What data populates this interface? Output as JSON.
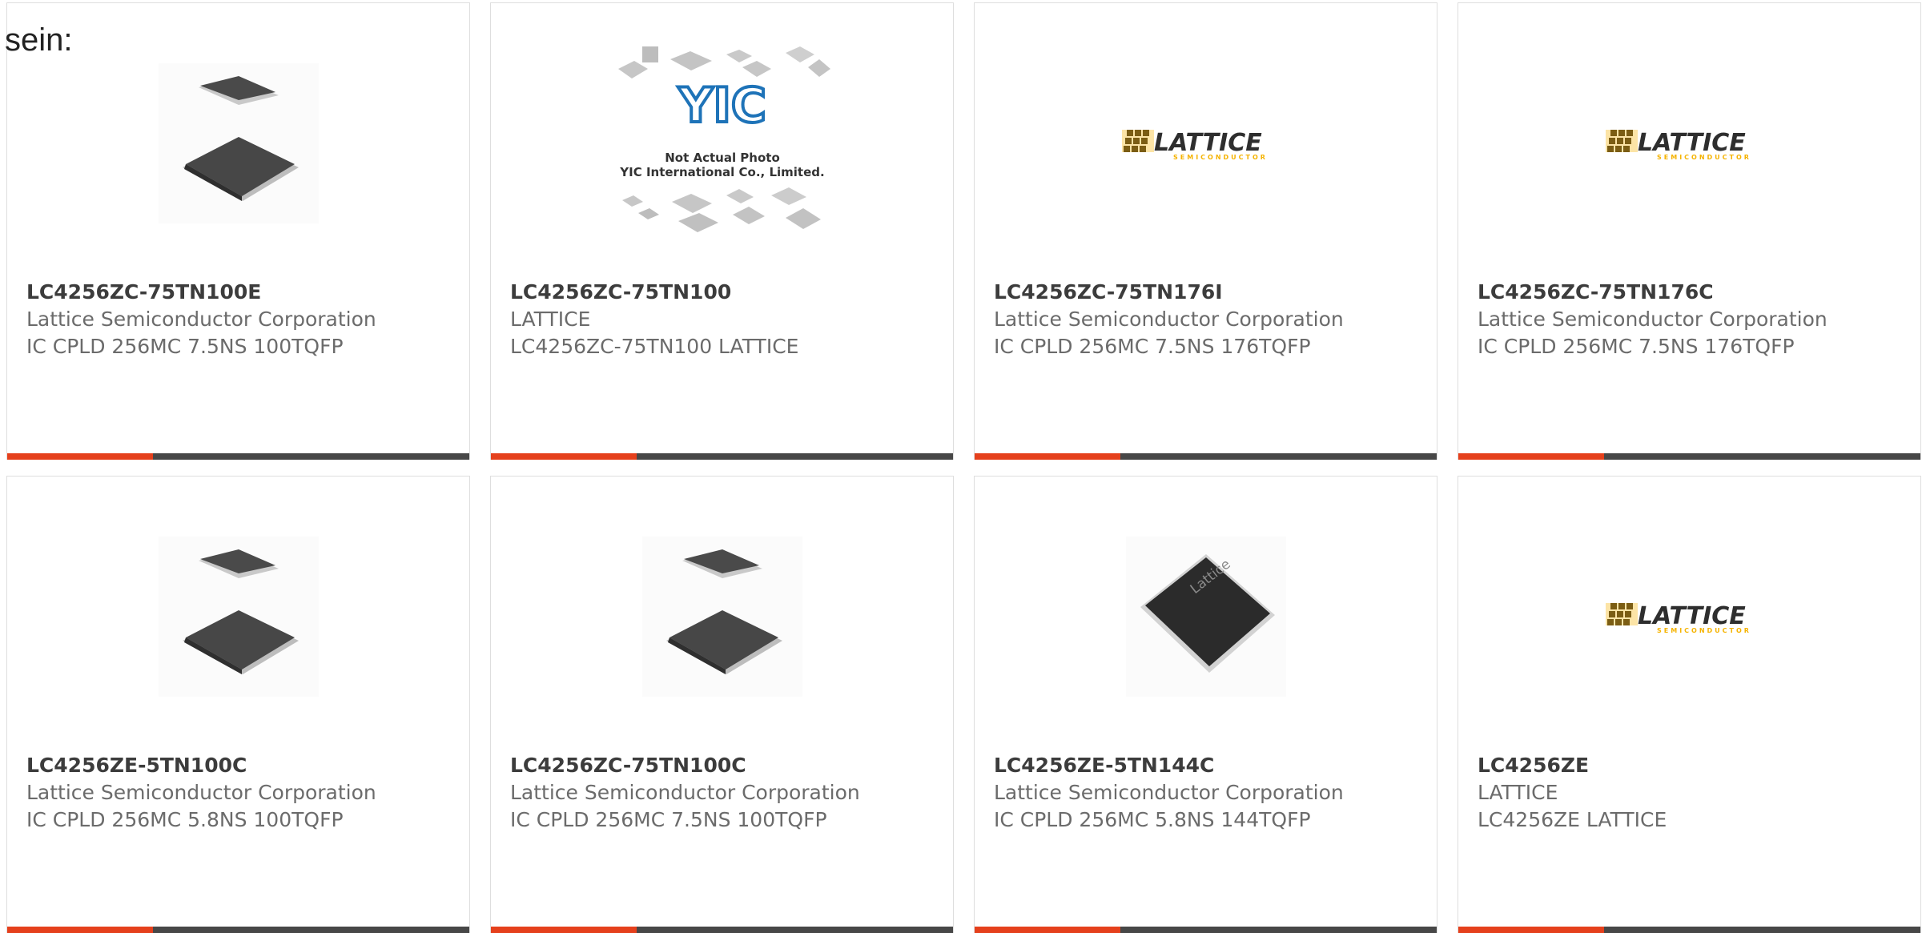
{
  "page": {
    "intro_text": "sein:"
  },
  "colors": {
    "accent": "#e5401c",
    "bar": "#474747",
    "lattice_yellow": "#f5b300"
  },
  "products": [
    {
      "part": "LC4256ZC-75TN100E",
      "manufacturer": "Lattice Semiconductor Corporation",
      "description": "IC CPLD 256MC 7.5NS 100TQFP",
      "image": "tqfp-chips-icon"
    },
    {
      "part": "LC4256ZC-75TN100",
      "manufacturer": "LATTICE",
      "description": "LC4256ZC-75TN100 LATTICE",
      "image": "yic-placeholder-icon",
      "image_caption_1": "Not Actual Photo",
      "image_caption_2": "YIC International Co., Limited.",
      "image_logo": "YIC"
    },
    {
      "part": "LC4256ZC-75TN176I",
      "manufacturer": "Lattice Semiconductor Corporation",
      "description": "IC CPLD 256MC 7.5NS 176TQFP",
      "image": "lattice-logo-icon",
      "logo_text": "LATTICE",
      "logo_sub": "SEMICONDUCTOR"
    },
    {
      "part": "LC4256ZC-75TN176C",
      "manufacturer": "Lattice Semiconductor Corporation",
      "description": "IC CPLD 256MC 7.5NS 176TQFP",
      "image": "lattice-logo-icon",
      "logo_text": "LATTICE",
      "logo_sub": "SEMICONDUCTOR"
    },
    {
      "part": "LC4256ZE-5TN100C",
      "manufacturer": "Lattice Semiconductor Corporation",
      "description": "IC CPLD 256MC 5.8NS 100TQFP",
      "image": "tqfp-chips-icon"
    },
    {
      "part": "LC4256ZC-75TN100C",
      "manufacturer": "Lattice Semiconductor Corporation",
      "description": "IC CPLD 256MC 7.5NS 100TQFP",
      "image": "tqfp-chips-icon"
    },
    {
      "part": "LC4256ZE-5TN144C",
      "manufacturer": "Lattice Semiconductor Corporation",
      "description": "IC CPLD 256MC 5.8NS 144TQFP",
      "image": "lattice-chip-icon",
      "chip_text": "Lattice"
    },
    {
      "part": "LC4256ZE",
      "manufacturer": "LATTICE",
      "description": "LC4256ZE LATTICE",
      "image": "lattice-logo-icon",
      "logo_text": "LATTICE",
      "logo_sub": "SEMICONDUCTOR"
    }
  ]
}
